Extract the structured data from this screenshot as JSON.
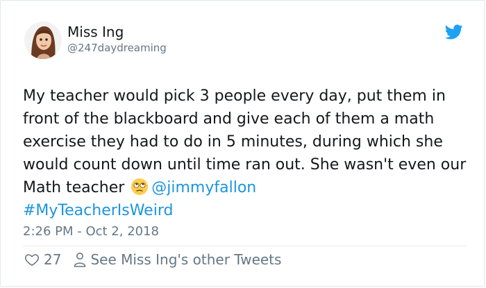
{
  "user": {
    "display_name": "Miss Ing",
    "handle": "@247daydreaming"
  },
  "tweet": {
    "text_before": "My teacher would pick 3 people every day, put them in front of the blackboard and give each of them a math exercise they had to do in 5 minutes, during which she would count down until time ran out. She wasn't even our Math teacher ",
    "mention": "@jimmyfallon",
    "hashtag": "#MyTeacherIsWeird",
    "timestamp": "2:26 PM - Oct 2, 2018"
  },
  "actions": {
    "likes": "27",
    "other_tweets_label": "See Miss Ing's other Tweets"
  },
  "icons": {
    "brand": "twitter-bird-icon",
    "like": "heart-icon",
    "profile": "person-icon",
    "emoji": "eye-roll-emoji-icon"
  },
  "colors": {
    "brand_blue": "#1da1f2",
    "link": "#1b95e0",
    "secondary_text": "#657786"
  }
}
